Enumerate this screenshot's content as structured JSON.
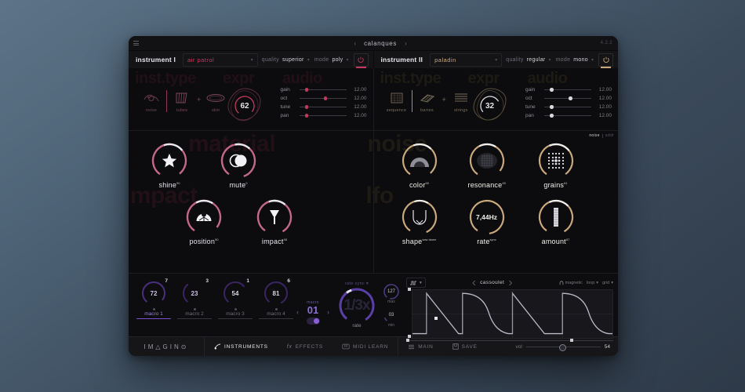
{
  "app": {
    "version": "4.2.2",
    "preset_name": "calanques",
    "prev_icon": "chevron-left-icon",
    "next_icon": "chevron-right-icon",
    "menu_icon": "hamburger-icon"
  },
  "instruments": [
    {
      "title": "instrument I",
      "patch": "air patrol",
      "quality_label": "quality",
      "quality_value": "superior",
      "mode_label": "mode",
      "mode_value": "poly",
      "power_icon": "power-icon",
      "watermarks": {
        "insttype": "inst.type",
        "expr": "expr",
        "audio": "audio"
      },
      "sources": [
        {
          "name": "noise",
          "icon": "noise-swirl-icon"
        },
        {
          "name": "tubes",
          "icon": "tubes-icon"
        },
        {
          "name": "skin",
          "icon": "skin-ellipse-icon"
        }
      ],
      "expr_value": "62",
      "sliders": [
        {
          "label": "gain",
          "value": "12.00",
          "pos": 12
        },
        {
          "label": "oct",
          "value": "12.00",
          "pos": 52
        },
        {
          "label": "tune",
          "value": "12.00",
          "pos": 12
        },
        {
          "label": "pan",
          "value": "12.00",
          "pos": 12
        }
      ],
      "accent": "#c4385f"
    },
    {
      "title": "instrument II",
      "patch": "paladin",
      "quality_label": "quality",
      "quality_value": "regular",
      "mode_label": "mode",
      "mode_value": "mono",
      "power_icon": "power-icon",
      "watermarks": {
        "insttype": "inst.type",
        "expr": "expr",
        "audio": "audio"
      },
      "sources": [
        {
          "name": "sequence",
          "icon": "sequence-grid-icon"
        },
        {
          "name": "barres",
          "icon": "barres-icon"
        },
        {
          "name": "strings",
          "icon": "strings-lines-icon"
        }
      ],
      "expr_value": "32",
      "sliders": [
        {
          "label": "gain",
          "value": "12.00",
          "pos": 12
        },
        {
          "label": "oct",
          "value": "12.00",
          "pos": 52
        },
        {
          "label": "tune",
          "value": "12.00",
          "pos": 12
        },
        {
          "label": "pan",
          "value": "12.00",
          "pos": 12
        }
      ],
      "accent": "#c9a87c"
    }
  ],
  "knob_panels": {
    "left": {
      "watermarks": [
        "material",
        "impact"
      ],
      "knobs": [
        {
          "label": "shine",
          "sup": "90",
          "icon": "star-icon"
        },
        {
          "label": "mute",
          "sup": "0",
          "icon": "eclipse-icon"
        },
        {
          "label": "position",
          "sup": "50",
          "icon": "position-dome-icon"
        },
        {
          "label": "impact",
          "sup": "98",
          "icon": "mallet-icon"
        }
      ]
    },
    "right": {
      "watermarks": [
        "noise",
        "lfo"
      ],
      "mode_toggle": {
        "on": "noise",
        "off": "addr"
      },
      "knobs": [
        {
          "label": "color",
          "sup": "50",
          "icon": "color-arc-icon",
          "value": ""
        },
        {
          "label": "resonance",
          "sup": "45",
          "icon": "resonance-mesh-icon",
          "value": ""
        },
        {
          "label": "grains",
          "sup": "61",
          "icon": "grains-dots-icon",
          "value": ""
        },
        {
          "label": "shape",
          "sup": "saw down",
          "icon": "shape-curve-icon",
          "value": ""
        },
        {
          "label": "rate",
          "sup": "sync",
          "icon": "",
          "value": "7,44Hz"
        },
        {
          "label": "amount",
          "sup": "87",
          "icon": "amount-bar-icon",
          "value": ""
        }
      ]
    }
  },
  "macro_strip": {
    "macros": [
      {
        "name": "macro 1",
        "value": "72",
        "index": "7",
        "active": true
      },
      {
        "name": "macro 2",
        "value": "23",
        "index": "3",
        "active": false
      },
      {
        "name": "macro 3",
        "value": "54",
        "index": "1",
        "active": false
      },
      {
        "name": "macro 4",
        "value": "81",
        "index": "6",
        "active": false
      }
    ],
    "preset_selector": {
      "label": "macro",
      "value": "01",
      "prev_icon": "chevron-left-icon",
      "next_icon": "chevron-right-icon",
      "toggle_state": "on"
    },
    "rate": {
      "sync_label": "rate sync",
      "sync_caret": "chevron-down-icon",
      "display": "1/3x",
      "label": "rate"
    },
    "range": [
      {
        "value": "127",
        "name": "max"
      },
      {
        "value": "03",
        "name": "min"
      }
    ]
  },
  "lfo_editor": {
    "waveform_icon": "waveform-icon",
    "waveform_caret": "chevron-down-icon",
    "prev_icon": "chevron-left-icon",
    "next_icon": "chevron-right-icon",
    "shape_name": "cassoulet",
    "magnetic_label": "magnetic",
    "magnetic_icon": "magnet-icon",
    "loop_label": "loop",
    "loop_caret": "chevron-down-icon",
    "grid_label": "grid",
    "grid_caret": "chevron-down-icon"
  },
  "bottom_nav": {
    "logo": "IM△GIN⊙",
    "items": [
      {
        "label": "INSTRUMENTS",
        "icon": "instruments-icon",
        "active": true
      },
      {
        "label": "EFFECTS",
        "icon": "fx-icon",
        "active": false
      },
      {
        "label": "MIDI LEARN",
        "icon": "midi-icon",
        "active": false
      }
    ],
    "right_items": [
      {
        "label": "MAIN",
        "icon": "list-icon"
      },
      {
        "label": "SAVE",
        "icon": "save-icon"
      }
    ],
    "volume": {
      "label": "vol",
      "value": "54"
    }
  }
}
